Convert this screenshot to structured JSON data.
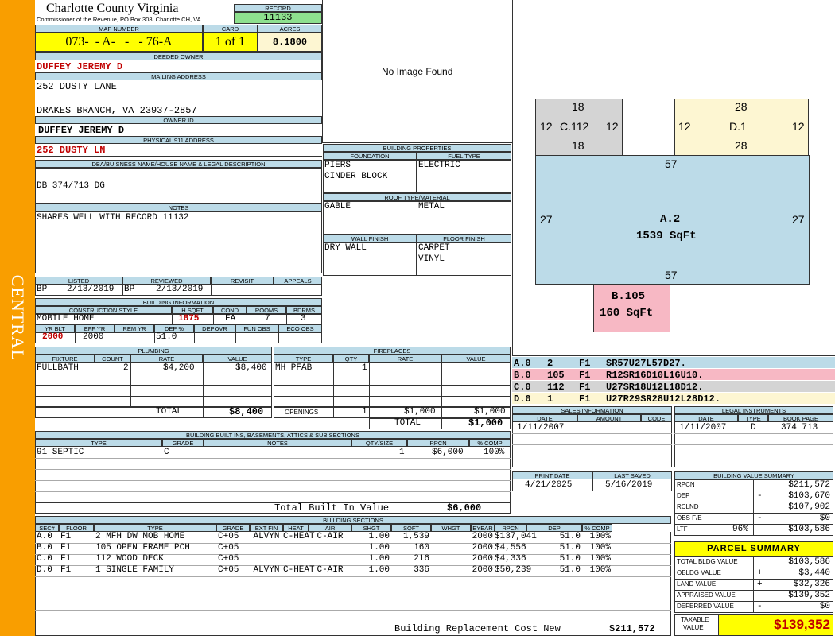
{
  "side_label": "CENTRAL",
  "header": {
    "county": "Charlotte County Virginia",
    "commissioner": "Commissioner of the Revenue, PO Box 308, Charlotte CH, VA",
    "record_label": "RECORD",
    "record": "11133",
    "map_number_label": "MAP NUMBER",
    "map_number": "073-  - A-   -   - 76-A",
    "card_label": "CARD",
    "card": "1 of 1",
    "acres_label": "ACRES",
    "acres": "8.1800"
  },
  "owner": {
    "deeded_label": "DEEDED OWNER",
    "deeded": "DUFFEY JEREMY D",
    "mailing_label": "MAILING ADDRESS",
    "mail1": "252 DUSTY LANE",
    "mail2": "DRAKES BRANCH, VA 23937-2857",
    "ownerid_label": "OWNER ID",
    "ownerid": "DUFFEY JEREMY D",
    "phys_label": "PHYSICAL 911 ADDRESS",
    "phys": "252 DUSTY LN",
    "dba_label": "DBA/BUISNESS NAME/HOUSE NAME & LEGAL DESCRIPTION",
    "dba": "DB 374/713 DG",
    "notes_label": "NOTES",
    "notes": "SHARES WELL WITH RECORD 11132"
  },
  "image": {
    "text": "No Image Found"
  },
  "bprops": {
    "title": "BUILDING PROPERTIES",
    "foundation_label": "FOUNDATION",
    "fuel_label": "FUEL TYPE",
    "found1": "PIERS",
    "found2": "CINDER BLOCK",
    "fuel": "ELECTRIC",
    "roof_label": "ROOF TYPE/MATERIAL",
    "roof_type": "GABLE",
    "roof_mat": "METAL",
    "wall_label": "WALL FINISH",
    "floor_label": "FLOOR FINISH",
    "wall": "DRY WALL",
    "floor1": "CARPET",
    "floor2": "VINYL"
  },
  "listed": {
    "listed_label": "LISTED",
    "reviewed_label": "REVIEWED",
    "revisit_label": "REVISIT",
    "appeals_label": "APPEALS",
    "listed_by": "BP",
    "listed_date": "2/13/2019",
    "reviewed_by": "BP",
    "reviewed_date": "2/13/2019"
  },
  "binfo": {
    "title": "BUILDING INFORMATION",
    "cs_label": "CONSTRUCTION STYLE",
    "hsqft_label": "H SQFT",
    "cond_label": "COND",
    "rooms_label": "ROOMS",
    "bdrms_label": "BDRMS",
    "cs": "MOBILE HOME",
    "hsqft": "1875",
    "cond": "FA",
    "rooms": "7",
    "bdrms": "3",
    "yrblt_label": "YR BLT",
    "effyr_label": "EFF YR",
    "remyr_label": "REM YR",
    "dep_label": "DEP %",
    "depovr_label": "DEPOVR",
    "funobs_label": "FUN OBS",
    "ecoobs_label": "ECO OBS",
    "yrblt": "2000",
    "effyr": "2000",
    "dep": "51.0"
  },
  "plumbing": {
    "title": "PLUMBING",
    "h_fixture": "FIXTURE",
    "h_count": "COUNT",
    "h_rate": "RATE",
    "h_value": "VALUE",
    "fixture": "FULLBATH",
    "count": "2",
    "rate": "$4,200",
    "value": "$8,400",
    "total_label": "TOTAL",
    "total": "$8,400"
  },
  "fireplaces": {
    "title": "FIREPLACES",
    "h_type": "TYPE",
    "h_qty": "QTY",
    "h_rate": "RATE",
    "h_value": "VALUE",
    "type": "MH PFAB",
    "qty": "1",
    "openings_label": "OPENINGS",
    "open_qty": "1",
    "open_rate": "$1,000",
    "open_value": "$1,000",
    "total_label": "TOTAL",
    "total": "$1,000"
  },
  "builtins": {
    "title": "BUILDING BUILT INS, BASEMENTS, ATTICS & SUB SECTIONS",
    "h_type": "TYPE",
    "h_grade": "GRADE",
    "h_notes": "NOTES",
    "h_qty": "QTY/SIZE",
    "h_rpcn": "RPCN",
    "h_comp": "% COMP",
    "type": "91 SEPTIC",
    "grade": "C",
    "qty": "1",
    "rpcn": "$6,000",
    "comp": "100%",
    "total_label": "Total Built In Value",
    "total": "$6,000"
  },
  "sketch": {
    "c": {
      "top": "18",
      "left": "12",
      "label": "C.112",
      "right": "12",
      "bottom": "18"
    },
    "d": {
      "top": "28",
      "left": "12",
      "label": "D.1",
      "right": "12",
      "bottom": "28"
    },
    "a": {
      "top": "57",
      "left": "27",
      "label": "A.2",
      "sqft": "1539 SqFt",
      "right": "27",
      "bottom": "57"
    },
    "b": {
      "label": "B.105",
      "sqft": "160 SqFt"
    }
  },
  "areas": [
    {
      "sec": "A.0",
      "n": "2",
      "fl": "F1",
      "path": "SR57U27L57D27.",
      "color": "#bcdbe8"
    },
    {
      "sec": "B.0",
      "n": "105",
      "fl": "F1",
      "path": "R12SR16D10L16U10.",
      "color": "#f7b8c4"
    },
    {
      "sec": "C.0",
      "n": "112",
      "fl": "F1",
      "path": "U27SR18U12L18D12.",
      "color": "#d4d4d4"
    },
    {
      "sec": "D.0",
      "n": "1",
      "fl": "F1",
      "path": "U27R29SR28U12L28D12.",
      "color": "#fdf6d2"
    }
  ],
  "sales": {
    "title": "SALES INFORMATION",
    "h_date": "DATE",
    "h_amount": "AMOUNT",
    "h_code": "CODE",
    "date": "1/11/2007"
  },
  "legal": {
    "title": "LEGAL INSTRUMENTS",
    "h_date": "DATE",
    "h_type": "TYPE",
    "h_book": "BOOK PAGE",
    "date": "1/11/2007",
    "type": "D",
    "book": "374 713"
  },
  "print": {
    "print_label": "PRINT DATE",
    "saved_label": "LAST SAVED",
    "print_date": "4/21/2025",
    "saved": "5/16/2019"
  },
  "bvs": {
    "title": "BUILDING VALUE SUMMARY",
    "rows": [
      {
        "label": "RPCN",
        "sign": "",
        "pct": "",
        "value": "$211,572"
      },
      {
        "label": "DEP",
        "sign": "-",
        "pct": "",
        "value": "$103,670"
      },
      {
        "label": "RCLND",
        "sign": "",
        "pct": "",
        "value": "$107,902"
      },
      {
        "label": "OBS F/E",
        "sign": "-",
        "pct": "",
        "value": "$0"
      },
      {
        "label": "LTF",
        "sign": "",
        "pct": "96%",
        "value": "$103,586"
      }
    ]
  },
  "parcel": {
    "title": "PARCEL SUMMARY",
    "rows": [
      {
        "label": "TOTAL BLDG VALUE",
        "sign": "",
        "value": "$103,586"
      },
      {
        "label": "OBLDG VALUE",
        "sign": "+",
        "value": "$3,440"
      },
      {
        "label": "LAND VALUE",
        "sign": "+",
        "value": "$32,326"
      },
      {
        "label": "APPRAISED VALUE",
        "sign": "",
        "value": "$139,352"
      },
      {
        "label": "DEFERRED VALUE",
        "sign": "-",
        "value": "$0"
      }
    ],
    "taxable_label1": "TAXABLE",
    "taxable_label2": "VALUE",
    "taxable": "$139,352"
  },
  "sections": {
    "title": "BUILDING SECTIONS",
    "headers": [
      "SEC#",
      "FLOOR",
      "TYPE",
      "GRADE",
      "EXT FIN",
      "HEAT",
      "AIR",
      "SHGT",
      "SQFT",
      "WHGT",
      "EYEAR",
      "RPCN",
      "DEP",
      "% COMP"
    ],
    "rows": [
      [
        "A.0",
        "F1",
        "2 MFH DW MOB HOME",
        "C+05",
        "ALVYN",
        "C-HEAT",
        "C-AIR",
        "1.00",
        "1,539",
        "",
        "2000",
        "$137,041",
        "51.0",
        "100%"
      ],
      [
        "B.0",
        "F1",
        "105 OPEN FRAME PCH",
        "C+05",
        "",
        "",
        "",
        "1.00",
        "160",
        "",
        "2000",
        "$4,556",
        "51.0",
        "100%"
      ],
      [
        "C.0",
        "F1",
        "112 WOOD DECK",
        "C+05",
        "",
        "",
        "",
        "1.00",
        "216",
        "",
        "2000",
        "$4,336",
        "51.0",
        "100%"
      ],
      [
        "D.0",
        "F1",
        "1 SINGLE FAMILY",
        "C+05",
        "ALVYN",
        "C-HEAT",
        "C-AIR",
        "1.00",
        "336",
        "",
        "2000",
        "$50,239",
        "51.0",
        "100%"
      ]
    ],
    "total_label": "Building Replacement Cost New",
    "total": "$211,572"
  }
}
